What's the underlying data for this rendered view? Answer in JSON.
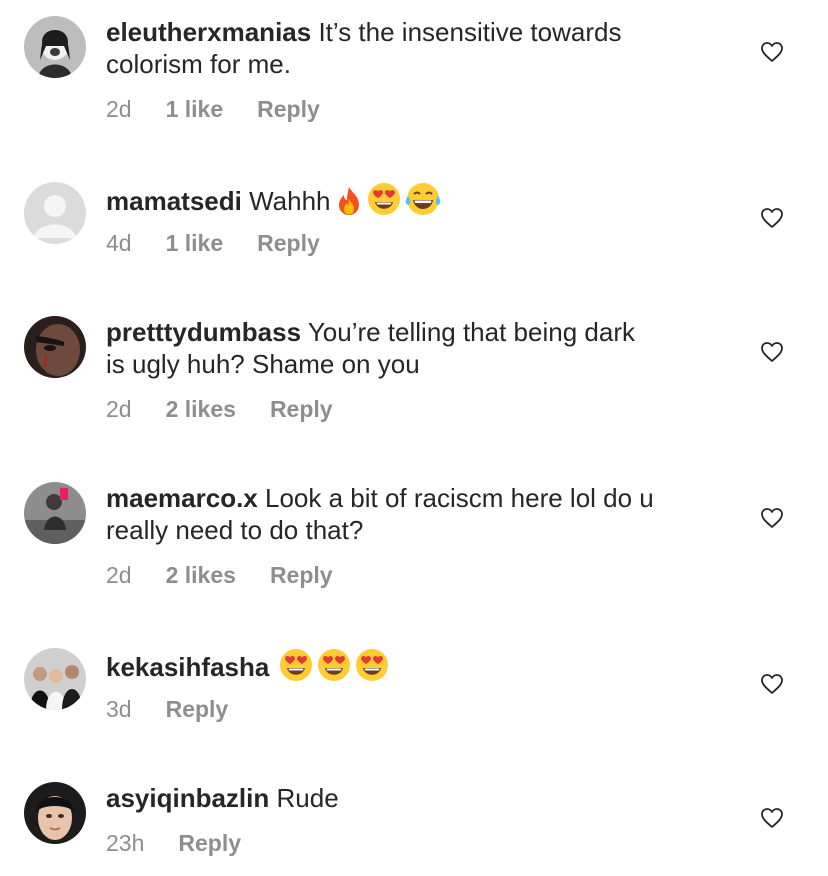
{
  "comments": [
    {
      "username": "eleutherxmanias",
      "text": "It’s the insensitive towards",
      "text2": "colorism for me.",
      "time": "2d",
      "likes": "1 like",
      "reply": "Reply"
    },
    {
      "username": "mamatsedi",
      "text": "Wahhh",
      "emojis": [
        "fire-emoji",
        "heart-eyes-emoji",
        "tears-of-joy-emoji"
      ],
      "time": "4d",
      "likes": "1 like",
      "reply": "Reply"
    },
    {
      "username": "pretttydumbass",
      "text": "You’re telling that being dark",
      "text2": "is ugly huh? Shame on you",
      "time": "2d",
      "likes": "2 likes",
      "reply": "Reply"
    },
    {
      "username": "maemarco.x",
      "text": "Look a bit of raciscm here lol do u",
      "text2": "really need to do that?",
      "time": "2d",
      "likes": "2 likes",
      "reply": "Reply"
    },
    {
      "username": "kekasihfasha",
      "text": "",
      "emojis": [
        "heart-eyes-emoji",
        "heart-eyes-emoji",
        "heart-eyes-emoji"
      ],
      "time": "3d",
      "reply": "Reply"
    },
    {
      "username": "asyiqinbazlin",
      "text": "Rude",
      "time": "23h",
      "reply": "Reply"
    }
  ],
  "colors": {
    "text": "#262626",
    "meta": "#8e8e8e",
    "heart_outline": "#262626"
  }
}
